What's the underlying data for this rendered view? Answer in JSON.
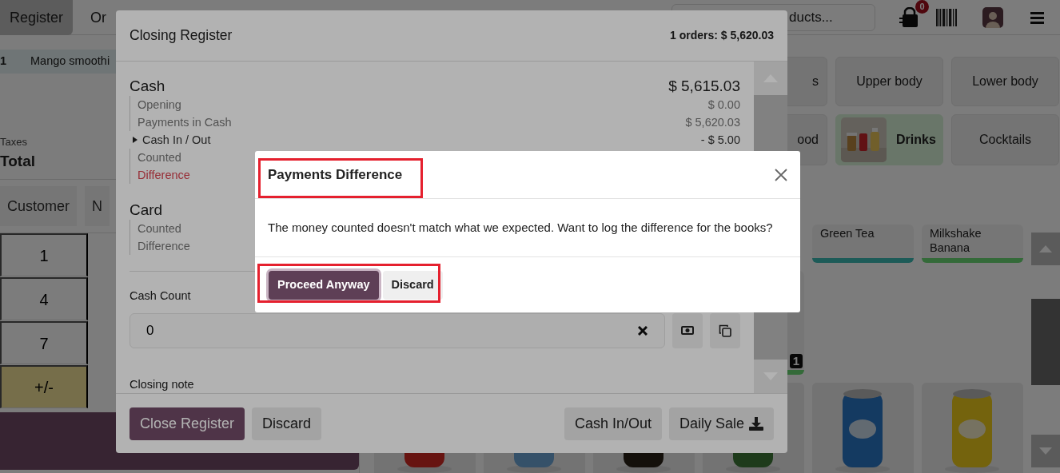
{
  "top_bar": {
    "tabs": [
      {
        "label": "Register",
        "selected": true
      },
      {
        "label": "Or",
        "selected": false
      }
    ],
    "search": {
      "placeholder": "ducts..."
    },
    "cart_badge": "0"
  },
  "order": {
    "lines": [
      {
        "quantity": "1",
        "name": "Mango smoothi"
      }
    ],
    "taxes_label": "Taxes",
    "total_label": "Total"
  },
  "action_buttons": [
    "Customer",
    "N"
  ],
  "numpad": [
    "1",
    "4",
    "7",
    "+/-"
  ],
  "categories": [
    {
      "label": "s",
      "kind": "plain",
      "selected": false
    },
    {
      "label": "Upper body",
      "kind": "plain",
      "selected": false
    },
    {
      "label": "Lower body",
      "kind": "plain",
      "selected": false
    },
    {
      "label": "ood",
      "kind": "plain",
      "selected": false
    },
    {
      "label": "Drinks",
      "selected": true
    },
    {
      "label": "Cocktails",
      "kind": "plain",
      "selected": false
    }
  ],
  "products": [
    {
      "name": "Green Tea",
      "color": "#1e5c59"
    },
    {
      "name": "Milkshake Banana",
      "color": "#356b3a"
    },
    {
      "quantity": "1",
      "color": "#356b3a"
    }
  ],
  "closing_register": {
    "title": "Closing Register",
    "summary": "1 orders: $ 5,620.03",
    "sections": [
      {
        "name": "Cash",
        "amount": "$ 5,615.03",
        "rows": [
          {
            "label": "Opening",
            "value": "$ 0.00",
            "kind": "plain"
          },
          {
            "label": "Payments in Cash",
            "value": "$ 5,620.03",
            "kind": "plain"
          },
          {
            "label": "Cash In / Out",
            "value": "- $ 5.00",
            "kind": "expandable",
            "expanded": false
          },
          {
            "label": "Counted",
            "kind": "plain"
          },
          {
            "label": "Difference",
            "kind": "warning"
          }
        ]
      },
      {
        "name": "Card",
        "rows": [
          {
            "label": "Counted",
            "kind": "plain"
          },
          {
            "label": "Difference",
            "kind": "plain"
          }
        ]
      }
    ],
    "cash_count": {
      "label": "Cash Count",
      "value": "0"
    },
    "closing_note_label": "Closing note",
    "footer_left_buttons": [
      {
        "label": "Close Register",
        "kind": "primary"
      },
      {
        "label": "Discard",
        "kind": "secondary"
      }
    ],
    "footer_right_buttons": [
      {
        "label": "Cash In/Out",
        "kind": "secondary"
      }
    ],
    "report_button": {
      "label": "Daily Sale"
    }
  },
  "dialog": {
    "title": "Payments Difference",
    "title_highlighted": true,
    "message": "The money counted doesn't match what we expected. Want to log the difference for the books?",
    "buttons": [
      {
        "label": "Proceed Anyway",
        "kind": "primary",
        "focused": true
      },
      {
        "label": "Discard",
        "kind": "secondary",
        "focused": false
      }
    ],
    "buttons_highlighted": true
  }
}
